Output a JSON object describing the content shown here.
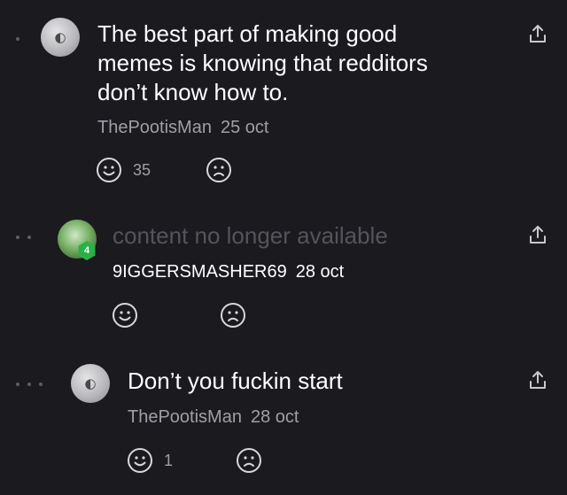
{
  "comments": [
    {
      "text": "The best part of making good memes is knowing that redditors don’t know how to.",
      "author": "ThePootisMan",
      "date": "25 oct",
      "likes": "35",
      "depth": 1
    },
    {
      "text": "content no longer available",
      "author": "9IGGERSMASHER69",
      "date": "28 oct",
      "likes": "",
      "level_badge": "4",
      "depth": 2
    },
    {
      "text": "Don’t you fuckin start",
      "author": "ThePootisMan",
      "date": "28 oct",
      "likes": "1",
      "depth": 3
    }
  ],
  "colors": {
    "background": "#1b1a1f",
    "text": "#ffffff",
    "muted": "#a09fa5",
    "removed": "#55545a",
    "badge": "#2ab047"
  },
  "icons": [
    "smile-icon",
    "frown-icon",
    "share-icon",
    "avatar",
    "thread-depth-dot"
  ]
}
